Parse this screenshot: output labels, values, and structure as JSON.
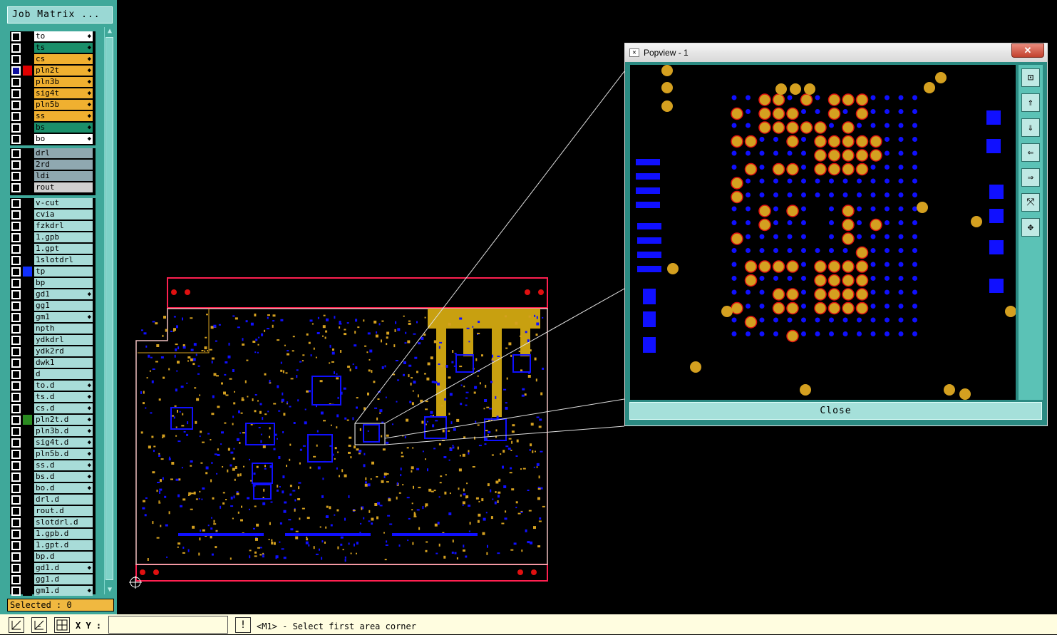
{
  "left_panel": {
    "job_matrix_label": "Job Matrix ...",
    "selected_label": "Selected : 0",
    "layers_group1": [
      {
        "name": "to",
        "color": "#ffffff",
        "checked": false,
        "swatch": "#000000"
      },
      {
        "name": "ts",
        "color": "#1a8f6a",
        "checked": false,
        "swatch": "#000000"
      },
      {
        "name": "cs",
        "color": "#f0b030",
        "checked": false,
        "swatch": "#000000"
      },
      {
        "name": "pln2t",
        "color": "#f0b030",
        "checked": true,
        "swatch": "#e00000"
      },
      {
        "name": "pln3b",
        "color": "#f0b030",
        "checked": false,
        "swatch": "#000000"
      },
      {
        "name": "sig4t",
        "color": "#f0b030",
        "checked": false,
        "swatch": "#000000"
      },
      {
        "name": "pln5b",
        "color": "#f0b030",
        "checked": false,
        "swatch": "#000000"
      },
      {
        "name": "ss",
        "color": "#f0b030",
        "checked": false,
        "swatch": "#000000"
      },
      {
        "name": "bs",
        "color": "#1a8f6a",
        "checked": false,
        "swatch": "#000000"
      },
      {
        "name": "bo",
        "color": "#ffffff",
        "checked": false,
        "swatch": "#000000"
      }
    ],
    "layers_group2": [
      {
        "name": "drl",
        "color": "#8fa8b0"
      },
      {
        "name": "2rd",
        "color": "#8fa8b0"
      },
      {
        "name": "ldi",
        "color": "#8fa8b0"
      },
      {
        "name": "rout",
        "color": "#d0d0d0"
      }
    ],
    "layers_group3": [
      {
        "name": "v-cut",
        "swatch": "#000000",
        "arrow": false
      },
      {
        "name": "cvia",
        "swatch": "#000000",
        "arrow": false
      },
      {
        "name": "fzkdrl",
        "swatch": "#000000",
        "arrow": false
      },
      {
        "name": "1.gpb",
        "swatch": "#000000",
        "arrow": false
      },
      {
        "name": "1.gpt",
        "swatch": "#000000",
        "arrow": false
      },
      {
        "name": "1slotdrl",
        "swatch": "#000000",
        "arrow": false
      },
      {
        "name": "tp",
        "swatch": "#1030ff",
        "arrow": false
      },
      {
        "name": "bp",
        "swatch": "#000000",
        "arrow": false
      },
      {
        "name": "gd1",
        "swatch": "#000000",
        "arrow": true
      },
      {
        "name": "gg1",
        "swatch": "#000000",
        "arrow": false
      },
      {
        "name": "gm1",
        "swatch": "#000000",
        "arrow": true
      },
      {
        "name": "npth",
        "swatch": "#000000",
        "arrow": false
      },
      {
        "name": "ydkdrl",
        "swatch": "#000000",
        "arrow": false
      },
      {
        "name": "ydk2rd",
        "swatch": "#000000",
        "arrow": false
      },
      {
        "name": "dwk1",
        "swatch": "#000000",
        "arrow": false
      },
      {
        "name": "d",
        "swatch": "#000000",
        "arrow": false
      },
      {
        "name": "to.d",
        "swatch": "#000000",
        "arrow": true
      },
      {
        "name": "ts.d",
        "swatch": "#000000",
        "arrow": true
      },
      {
        "name": "cs.d",
        "swatch": "#000000",
        "arrow": true
      },
      {
        "name": "pln2t.d",
        "swatch": "#2a8a20",
        "arrow": true
      },
      {
        "name": "pln3b.d",
        "swatch": "#000000",
        "arrow": true
      },
      {
        "name": "sig4t.d",
        "swatch": "#000000",
        "arrow": true
      },
      {
        "name": "pln5b.d",
        "swatch": "#000000",
        "arrow": true
      },
      {
        "name": "ss.d",
        "swatch": "#000000",
        "arrow": true
      },
      {
        "name": "bs.d",
        "swatch": "#000000",
        "arrow": true
      },
      {
        "name": "bo.d",
        "swatch": "#000000",
        "arrow": true
      },
      {
        "name": "drl.d",
        "swatch": "#000000",
        "arrow": false
      },
      {
        "name": "rout.d",
        "swatch": "#000000",
        "arrow": false
      },
      {
        "name": "slotdrl.d",
        "swatch": "#000000",
        "arrow": false
      },
      {
        "name": "1.gpb.d",
        "swatch": "#000000",
        "arrow": false
      },
      {
        "name": "1.gpt.d",
        "swatch": "#000000",
        "arrow": false
      },
      {
        "name": "bp.d",
        "swatch": "#000000",
        "arrow": false
      },
      {
        "name": "gd1.d",
        "swatch": "#000000",
        "arrow": true
      },
      {
        "name": "gg1.d",
        "swatch": "#000000",
        "arrow": false
      },
      {
        "name": "gm1.d",
        "swatch": "#000000",
        "arrow": true
      }
    ],
    "layer_text_color": "#a8dcd8"
  },
  "statusbar": {
    "xy_label": "X Y :",
    "xy_value": "",
    "message": "<M1> - Select first area corner",
    "message_button": "!"
  },
  "popview": {
    "title": "Popview - 1",
    "close_x": "✕",
    "close_button": "Close",
    "toolbar_icons": [
      "zoom-region-icon",
      "move-up-icon",
      "move-down-icon",
      "move-left-icon",
      "move-right-icon",
      "zoom-fit-icon",
      "pan-icon"
    ]
  },
  "colors": {
    "panel_bg": "#3fa89a",
    "board_outline": "#ff2050",
    "copper": "#d4a020",
    "pad_blue": "#1010ff",
    "pad_red": "#e01010"
  }
}
